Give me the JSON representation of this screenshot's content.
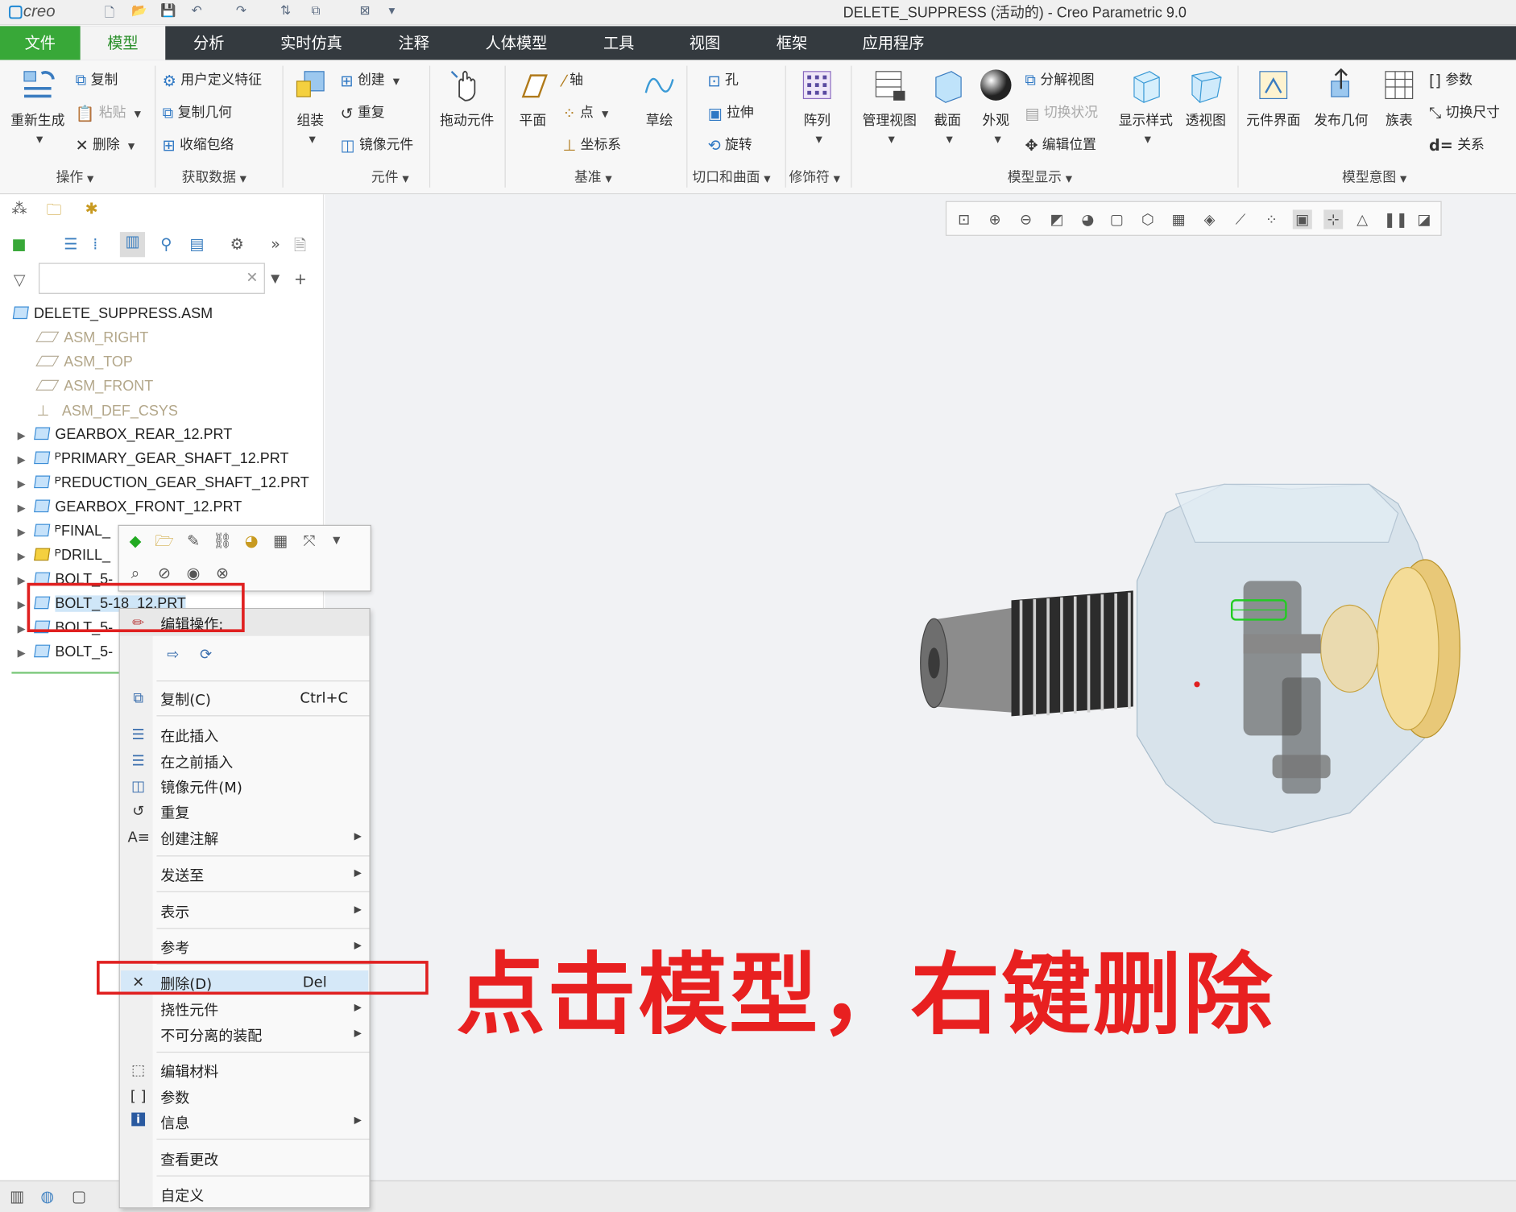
{
  "app": {
    "logo": "creo",
    "window_title": "DELETE_SUPPRESS (活动的) - Creo Parametric 9.0"
  },
  "tabs": [
    "文件",
    "模型",
    "分析",
    "实时仿真",
    "注释",
    "人体模型",
    "工具",
    "视图",
    "框架",
    "应用程序"
  ],
  "ribbon": {
    "regen": "重新生成",
    "copy": "复制",
    "paste": "粘贴",
    "delete": "删除",
    "udf": "用户定义特征",
    "copy_geom": "复制几何",
    "shrinkwrap": "收缩包络",
    "create": "创建",
    "repeat": "重复",
    "mirror_comp": "镜像元件",
    "assemble": "组装",
    "drag": "拖动元件",
    "plane": "平面",
    "axis": "轴",
    "point": "点",
    "csys": "坐标系",
    "sketch": "草绘",
    "hole": "孔",
    "extrude": "拉伸",
    "revolve": "旋转",
    "pattern": "阵列",
    "manage_view": "管理视图",
    "section": "截面",
    "appearance": "外观",
    "explode": "分解视图",
    "toggle_status": "切换状况",
    "edit_pos": "编辑位置",
    "display_style": "显示样式",
    "perspective": "透视图",
    "comp_iface": "元件界面",
    "publish_geom": "发布几何",
    "family_table": "族表",
    "params": "参数",
    "switch_dim": "切换尺寸",
    "relations": "关系",
    "groups": [
      "操作",
      "获取数据",
      "元件",
      "基准",
      "切口和曲面",
      "修饰符",
      "模型显示",
      "模型意图"
    ]
  },
  "tree": {
    "root": "DELETE_SUPPRESS.ASM",
    "datums": [
      "ASM_RIGHT",
      "ASM_TOP",
      "ASM_FRONT",
      "ASM_DEF_CSYS"
    ],
    "parts": [
      "GEARBOX_REAR_12.PRT",
      "ᴾPRIMARY_GEAR_SHAFT_12.PRT",
      "ᴾREDUCTION_GEAR_SHAFT_12.PRT",
      "GEARBOX_FRONT_12.PRT",
      "ᴾFINAL_",
      "ᴾDRILL_",
      "BOLT_5-",
      "BOLT_5-18_12.PRT",
      "BOLT_5-",
      "BOLT_5-"
    ]
  },
  "context_menu": {
    "header": "编辑操作:",
    "copy": "复制(C)",
    "copy_shortcut": "Ctrl+C",
    "insert_here": "在此插入",
    "insert_before": "在之前插入",
    "mirror": "镜像元件(M)",
    "repeat": "重复",
    "create_annotation": "创建注解",
    "send_to": "发送至",
    "represent": "表示",
    "reference": "参考",
    "delete": "删除(D)",
    "delete_shortcut": "Del",
    "flexible": "挠性元件",
    "inseparable": "不可分离的装配",
    "edit_material": "编辑材料",
    "parameters": "参数",
    "info": "信息",
    "view_changes": "查看更改",
    "customize": "自定义"
  },
  "annotation": "点击模型，右键删除",
  "colors": {
    "accent_green": "#2a8f2a",
    "file_tab": "#38a838",
    "annotation_red": "#e82020"
  }
}
